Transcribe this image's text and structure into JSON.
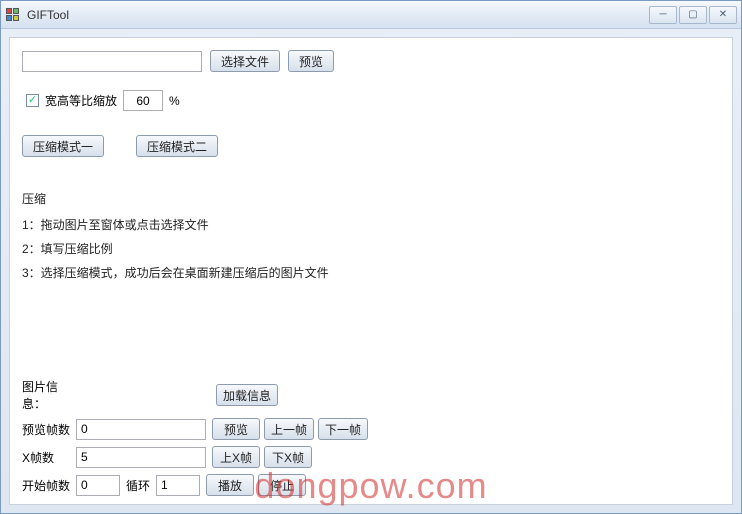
{
  "window": {
    "title": "GIFTool"
  },
  "toolbar": {
    "choose_file": "选择文件",
    "preview": "预览"
  },
  "scale": {
    "checkbox_label": "宽高等比缩放",
    "value": "60",
    "suffix": "%"
  },
  "modes": {
    "mode1": "压缩模式一",
    "mode2": "压缩模式二"
  },
  "instructions": {
    "header": "压缩",
    "line1": "1：拖动图片至窗体或点击选择文件",
    "line2": "2：填写压缩比例",
    "line3": "3：选择压缩模式，成功后会在桌面新建压缩后的图片文件"
  },
  "info": {
    "title": "图片信息：",
    "load_btn": "加载信息",
    "preview_frames_label": "预览帧数",
    "preview_frames_value": "0",
    "preview_btn": "预览",
    "prev_frame_btn": "上一帧",
    "next_frame_btn": "下一帧",
    "x_frames_label": "X帧数",
    "x_frames_value": "5",
    "up_x_btn": "上X帧",
    "down_x_btn": "下X帧",
    "start_frames_label": "开始帧数",
    "start_frames_value": "0",
    "loop_label": "循环",
    "loop_value": "1",
    "play_btn": "播放",
    "stop_btn": "停止"
  },
  "watermark": "dongpow.com"
}
